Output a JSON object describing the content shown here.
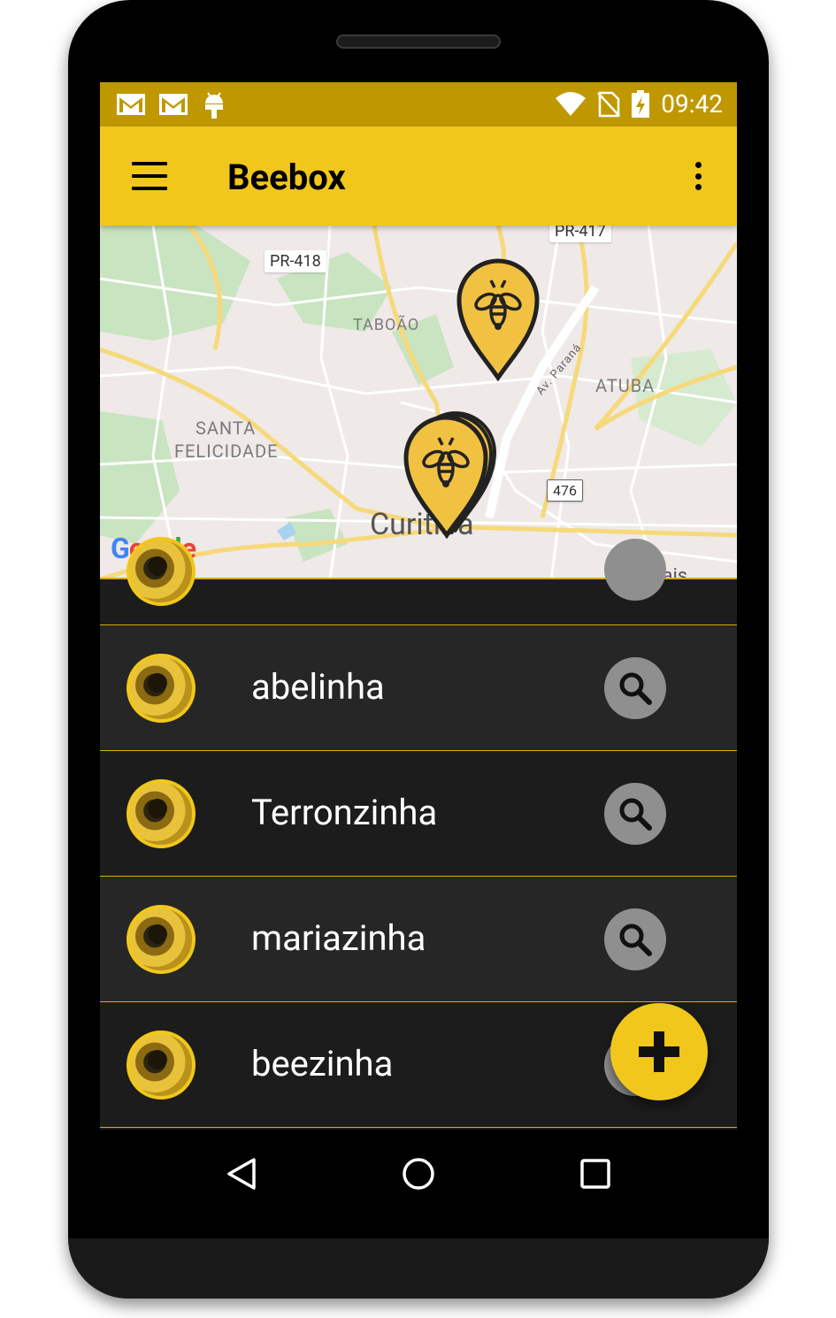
{
  "status_bar": {
    "time": "09:42",
    "left_icons": [
      "gmail-icon",
      "gmail-icon",
      "android-debug-icon"
    ],
    "right_icons": [
      "wifi-icon",
      "no-sim-icon",
      "battery-charging-icon"
    ]
  },
  "app_bar": {
    "title": "Beebox",
    "menu_icon": "hamburger-menu-icon",
    "overflow_icon": "more-vert-icon"
  },
  "map": {
    "labels": {
      "pr418": "PR-418",
      "pr417": "PR-417",
      "taboao": "TABOÃO",
      "atuba": "ATUBA",
      "santa_felicidade_1": "SANTA",
      "santa_felicidade_2": "FELICIDADE",
      "curitiba": "Curitiba",
      "av_parana": "Av. Paraná",
      "route476": "476",
      "pinhais": "Pinhais",
      "google": "Google"
    },
    "markers": [
      "bee-marker",
      "bee-marker-cluster"
    ]
  },
  "hives": [
    {
      "name": "abelinha"
    },
    {
      "name": "Terronzinha"
    },
    {
      "name": "mariazinha"
    },
    {
      "name": "beezinha"
    }
  ],
  "fab": {
    "icon": "plus-icon"
  },
  "colors": {
    "primary": "#f1c71c",
    "status_bar": "#bf9800",
    "row_dark": "#1c1c1c",
    "row_light": "#262626",
    "divider": "#d9b000"
  }
}
